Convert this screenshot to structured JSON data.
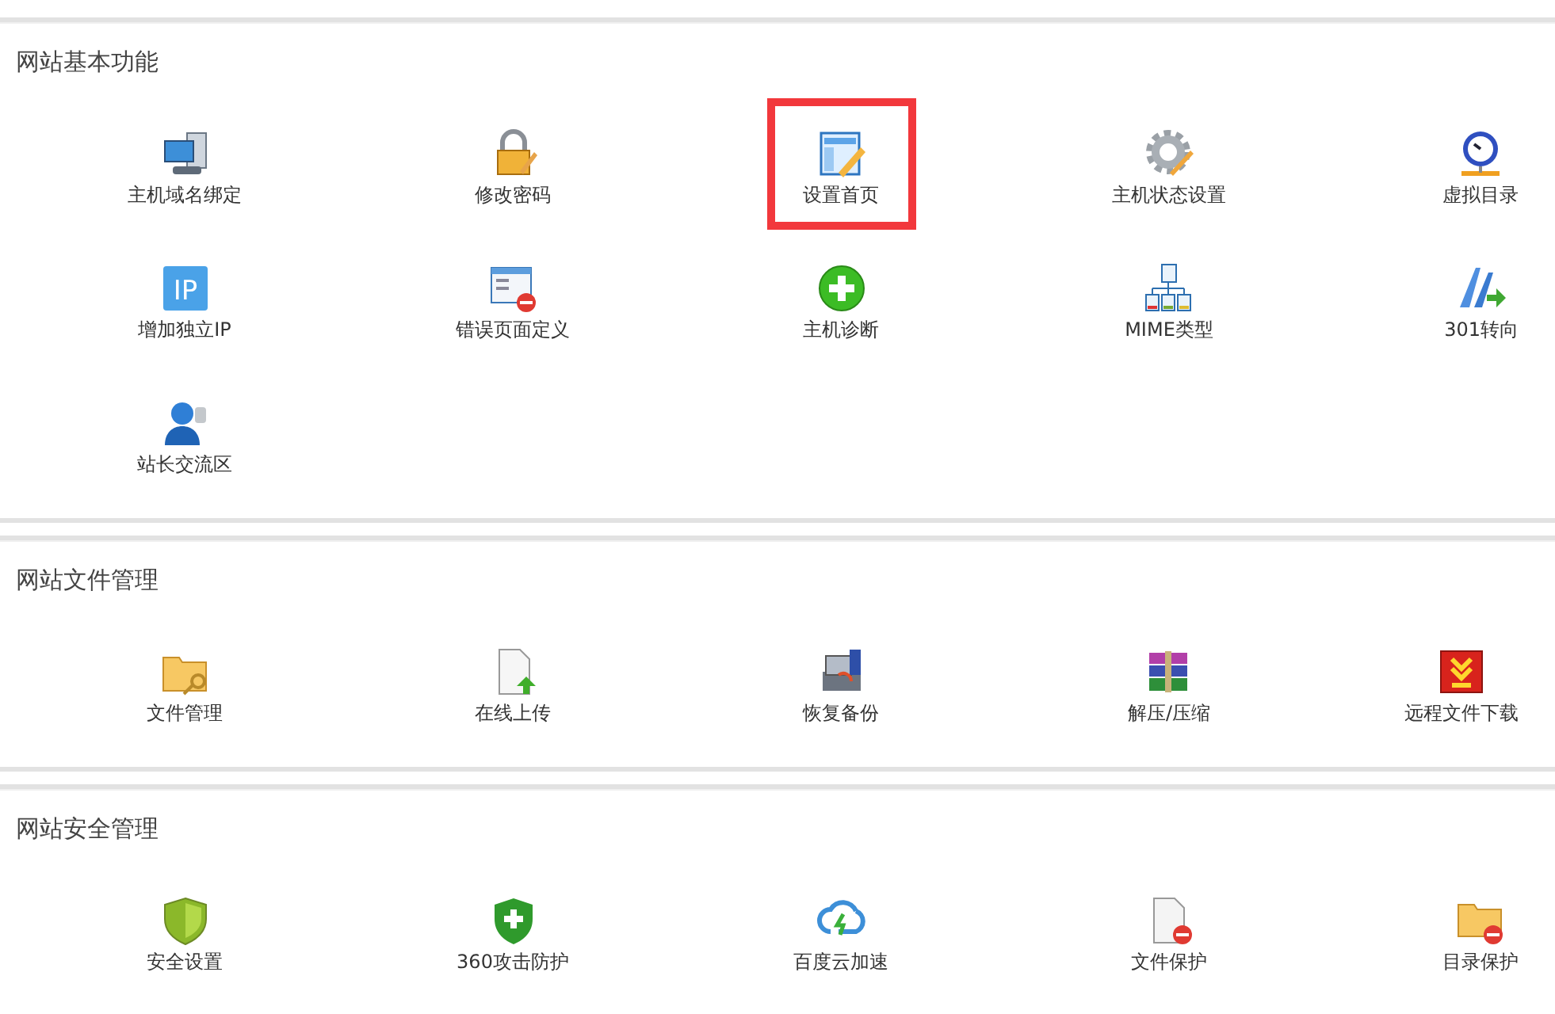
{
  "sections": [
    {
      "title": "网站基本功能",
      "items": [
        {
          "label": "主机域名绑定",
          "highlighted": false
        },
        {
          "label": "修改密码",
          "highlighted": false
        },
        {
          "label": "设置首页",
          "highlighted": true
        },
        {
          "label": "主机状态设置",
          "highlighted": false
        },
        {
          "label": "虚拟目录",
          "highlighted": false
        },
        {
          "label": "增加独立IP",
          "highlighted": false,
          "icon_text": "IP"
        },
        {
          "label": "错误页面定义",
          "highlighted": false
        },
        {
          "label": "主机诊断",
          "highlighted": false
        },
        {
          "label": "MIME类型",
          "highlighted": false
        },
        {
          "label": "301转向",
          "highlighted": false
        },
        {
          "label": "站长交流区",
          "highlighted": false
        }
      ]
    },
    {
      "title": "网站文件管理",
      "items": [
        {
          "label": "文件管理",
          "highlighted": false
        },
        {
          "label": "在线上传",
          "highlighted": false
        },
        {
          "label": "恢复备份",
          "highlighted": false
        },
        {
          "label": "解压/压缩",
          "highlighted": false
        },
        {
          "label": "远程文件下载",
          "highlighted": false
        }
      ]
    },
    {
      "title": "网站安全管理",
      "items": [
        {
          "label": "安全设置",
          "highlighted": false
        },
        {
          "label": "360攻击防护",
          "highlighted": false
        },
        {
          "label": "百度云加速",
          "highlighted": false
        },
        {
          "label": "文件保护",
          "highlighted": false
        },
        {
          "label": "目录保护",
          "highlighted": false
        }
      ]
    }
  ]
}
